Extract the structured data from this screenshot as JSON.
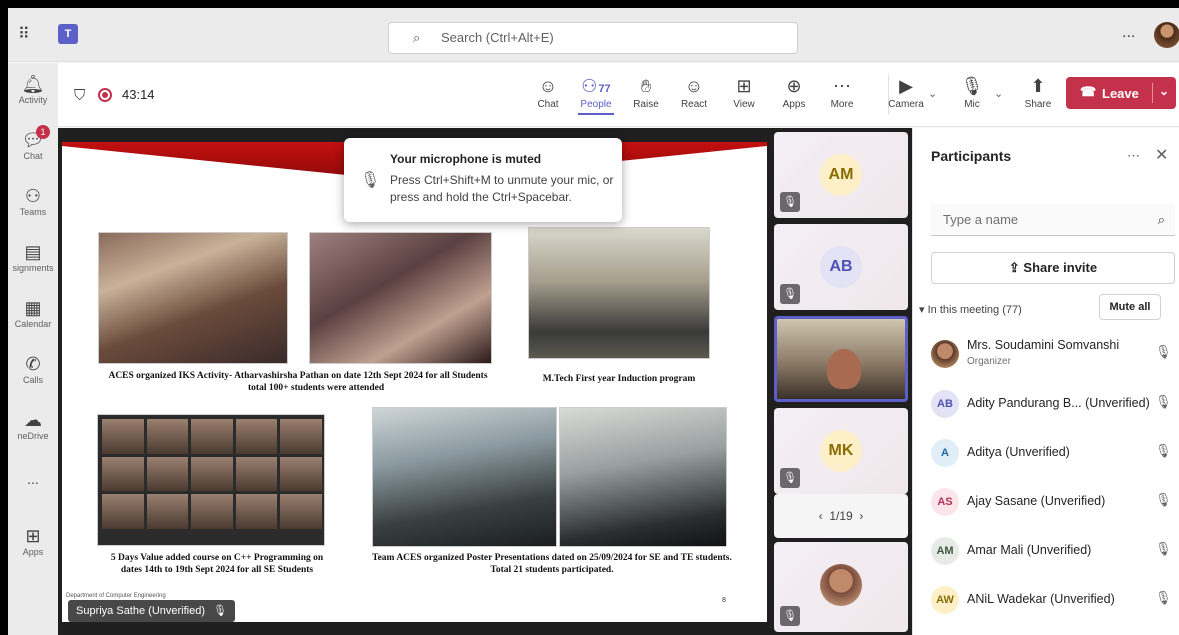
{
  "titlebar": {
    "search_placeholder": "Search (Ctrl+Alt+E)",
    "more": "..."
  },
  "rail": {
    "items": [
      {
        "label": "Activity",
        "icon": "bell-icon"
      },
      {
        "label": "Chat",
        "icon": "chat-icon",
        "badge": "1"
      },
      {
        "label": "Teams",
        "icon": "teams-icon"
      },
      {
        "label": "signments",
        "icon": "assignments-icon"
      },
      {
        "label": "Calendar",
        "icon": "calendar-icon"
      },
      {
        "label": "Calls",
        "icon": "phone-icon"
      },
      {
        "label": "neDrive",
        "icon": "cloud-icon"
      },
      {
        "label": "...",
        "icon": "more-icon"
      },
      {
        "label": "Apps",
        "icon": "apps-icon"
      }
    ]
  },
  "meeting": {
    "timer": "43:14",
    "people_count": "77",
    "buttons": {
      "chat": "Chat",
      "people": "People",
      "raise": "Raise",
      "react": "React",
      "view": "View",
      "apps": "Apps",
      "more": "More",
      "camera": "Camera",
      "mic": "Mic",
      "share": "Share",
      "leave": "Leave"
    }
  },
  "toast": {
    "title": "Your microphone is muted",
    "body": "Press Ctrl+Shift+M to unmute your mic, or press and hold the Ctrl+Spacebar."
  },
  "slide": {
    "captions": {
      "c1_line1": "ACES organized IKS Activity- Atharvashirsha Pathan on  date 12th Sept 2024 for all  Students",
      "c1_line2": "total 100+ students were attended",
      "c2": "M.Tech First year Induction program",
      "c3_line1": "5 Days Value added course on C++ Programming on",
      "c3_line2": "dates 14th to 19th Sept 2024 for all  SE Students",
      "c4_line1": "Team ACES organized  Poster Presentations dated on 25/09/2024 for SE and TE students.",
      "c4_line2": "Total 21 students participated."
    },
    "footer": "Department of Computer Engineering",
    "page_number": "8",
    "presenter": "Supriya Sathe (Unverified)"
  },
  "strip": {
    "tiles": [
      {
        "initials": "AM",
        "bg": "#fdf0c9",
        "fg": "#8a6d00"
      },
      {
        "initials": "AB",
        "bg": "#e4e2f5",
        "fg": "#4f52b2"
      },
      {
        "initials": "",
        "video": true
      },
      {
        "initials": "MK",
        "bg": "#fdf0c9",
        "fg": "#8a6d00"
      }
    ],
    "pager": "1/19"
  },
  "participants": {
    "title": "Participants",
    "search_placeholder": "Type a name",
    "share_invite": "Share invite",
    "in_meeting": "In this meeting (77)",
    "mute_all": "Mute all",
    "list": [
      {
        "initials": "",
        "name": "Mrs. Soudamini Somvanshi",
        "role": "Organizer",
        "photo": true
      },
      {
        "initials": "AB",
        "name": "Adity Pandurang B... (Unverified)",
        "bg": "#e4e2f5",
        "fg": "#4f52b2"
      },
      {
        "initials": "A",
        "name": "Aditya (Unverified)",
        "bg": "#e1eef7",
        "fg": "#1f6aa5"
      },
      {
        "initials": "AS",
        "name": "Ajay Sasane (Unverified)",
        "bg": "#fbe4ea",
        "fg": "#b1325a"
      },
      {
        "initials": "AM",
        "name": "Amar Mali (Unverified)",
        "bg": "#e6ebe6",
        "fg": "#3f5a3f"
      },
      {
        "initials": "AW",
        "name": "ANiL Wadekar (Unverified)",
        "bg": "#fdf0c9",
        "fg": "#8a6d00"
      }
    ]
  },
  "colors": {
    "accent": "#5b5fc7",
    "leave": "#c4314b"
  }
}
